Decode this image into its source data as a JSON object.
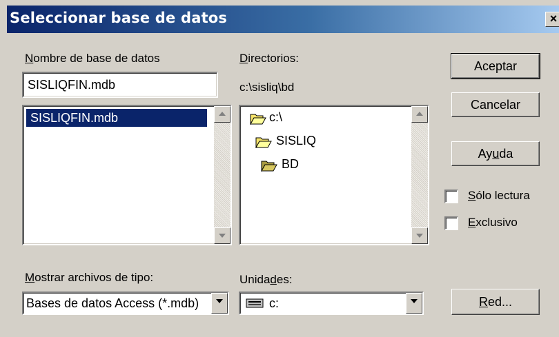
{
  "window": {
    "title": "Seleccionar base de datos",
    "close_glyph": "×"
  },
  "db_name": {
    "label_u": "N",
    "label_rest": "ombre de base de datos",
    "value": "SISLIQFIN.mdb",
    "list_items": [
      "SISLIQFIN.mdb"
    ]
  },
  "directories": {
    "label_u": "D",
    "label_rest": "irectorios:",
    "current_path": "c:\\sisliq\\bd",
    "tree": [
      "c:\\",
      "SISLIQ",
      "BD"
    ]
  },
  "buttons": {
    "accept": "Aceptar",
    "cancel": "Cancelar",
    "help_pre": "Ay",
    "help_u": "u",
    "help_post": "da",
    "network_u": "R",
    "network_post": "ed..."
  },
  "options": {
    "readonly_u": "S",
    "readonly_post": "ólo lectura",
    "exclusive_u": "E",
    "exclusive_post": "xclusivo",
    "readonly_checked": false,
    "exclusive_checked": false
  },
  "file_type": {
    "label_u": "M",
    "label_rest": "ostrar archivos de tipo:",
    "value": "Bases de datos Access (*.mdb)"
  },
  "drives": {
    "label_pre": "Unida",
    "label_u": "d",
    "label_post": "es:",
    "value": "c:"
  },
  "colors": {
    "title_start": "#0a246a",
    "title_end": "#a6caf0",
    "selection": "#0a246a",
    "face": "#d4d0c8"
  },
  "icons": [
    "close-icon",
    "folder-open-icon",
    "drive-icon",
    "scroll-up-arrow",
    "scroll-down-arrow",
    "dropdown-arrow"
  ]
}
